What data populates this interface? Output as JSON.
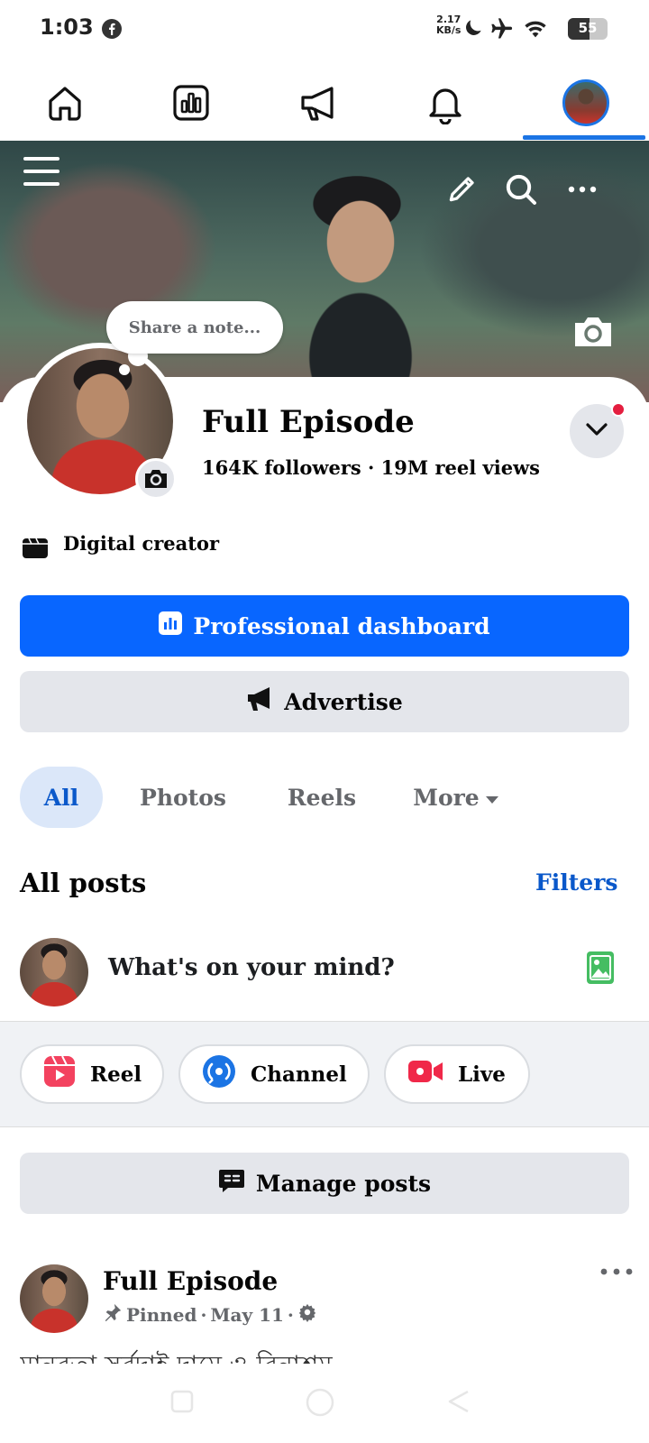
{
  "status_bar": {
    "time": "1:03",
    "net_speed_value": "2.17",
    "net_speed_unit": "KB/s",
    "battery": "55",
    "battery_level": 0.55,
    "icons": [
      "facebook-icon",
      "moon-icon",
      "airplane-icon",
      "wifi-icon",
      "battery-icon"
    ]
  },
  "nav": {
    "items": [
      "home-icon",
      "dashboard-icon",
      "megaphone-icon",
      "bell-icon",
      "profile-avatar"
    ],
    "active": "profile-avatar",
    "accent": "#1b74e4"
  },
  "profile": {
    "note_prompt": "Share a note...",
    "name": "Full Episode",
    "followers": "164K followers",
    "separator": "·",
    "reel_views": "19M reel views",
    "category": "Digital creator"
  },
  "buttons": {
    "professional_dashboard": "Professional dashboard",
    "advertise": "Advertise",
    "manage_posts": "Manage posts"
  },
  "tabs": [
    "All",
    "Photos",
    "Reels",
    "More"
  ],
  "posts_section": {
    "title": "All posts",
    "filters": "Filters",
    "composer_prompt": "What's on your mind?"
  },
  "create_options": [
    "Reel",
    "Channel",
    "Live"
  ],
  "post": {
    "author": "Full Episode",
    "pinned": "Pinned",
    "date": "May 11",
    "dot": "·",
    "text_preview": "মানবতা সর্বদাই দামে ও বিনাশ্রম"
  },
  "colors": {
    "primary_blue": "#0866ff",
    "link_blue": "#0a58ca",
    "grey_button": "#e4e6eb",
    "notification_red": "#e41e3f",
    "reel_red": "#f3425f",
    "photo_green": "#45bd62",
    "channel_blue": "#1b74e4",
    "live_red": "#f02849"
  }
}
